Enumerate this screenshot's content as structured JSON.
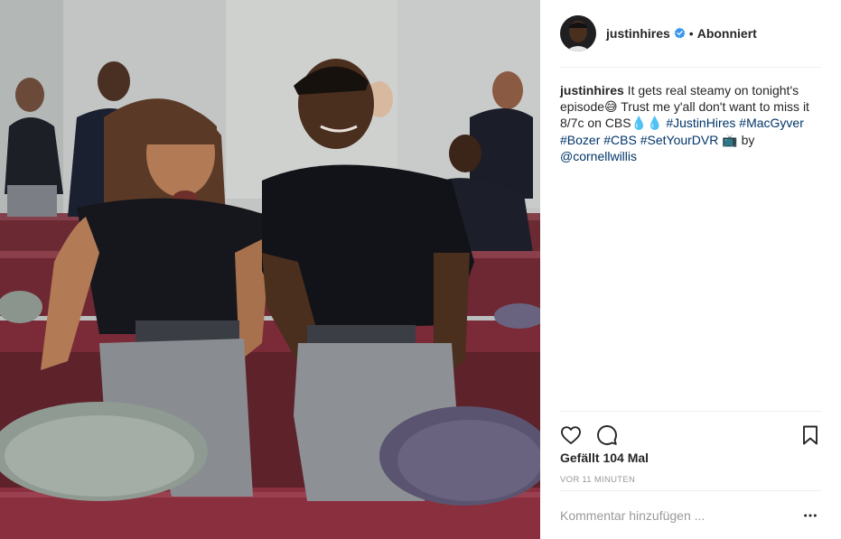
{
  "post": {
    "photo_alt": "",
    "header": {
      "username": "justinhires",
      "separator": "•",
      "follow_status": "Abonniert",
      "avatar_icon": "profile-avatar",
      "verified_icon": "verified-badge-icon"
    },
    "caption": {
      "username": "justinhires",
      "text_1": " It gets real steamy on tonight's episode😅 Trust me y'all don't want to miss it 8/7c on CBS💧💧 ",
      "tags": [
        "#JustinHires",
        "#MacGyver",
        "#Bozer",
        "#CBS",
        "#SetYourDVR"
      ],
      "text_2": " 📺 by ",
      "mention": "@cornellwillis"
    },
    "actions": {
      "like_icon": "heart-icon",
      "comment_icon": "comment-icon",
      "save_icon": "bookmark-icon"
    },
    "likes": "Gefällt 104 Mal",
    "timestamp": "VOR 11 MINUTEN",
    "comment": {
      "placeholder": "Kommentar hinzufügen ...",
      "more_icon": "more-options-icon"
    },
    "colors": {
      "link": "#003569",
      "verified": "#3897f0",
      "divider": "#efefef",
      "muted": "#999999"
    }
  }
}
